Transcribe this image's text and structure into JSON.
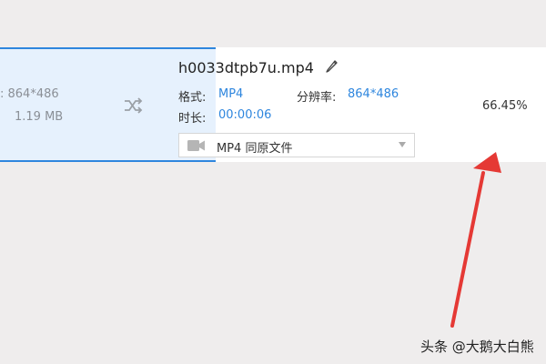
{
  "source_panel": {
    "resolution": ": 864*486",
    "size": "1.19 MB"
  },
  "output": {
    "filename": "h0033dtpb7u.mp4",
    "format_label": "格式:",
    "format_value": "MP4",
    "resolution_label": "分辨率:",
    "resolution_value": "864*486",
    "duration_label": "时长:",
    "duration_value": "00:00:06",
    "progress": "66.45%",
    "progress_value": 0.6645,
    "preset_value": "MP4  同原文件"
  },
  "icons": {
    "shuffle": "shuffle-icon",
    "edit": "pencil-icon",
    "video": "video-camera-icon",
    "dropdown": "chevron-down-icon"
  },
  "colors": {
    "accent": "#2e86de",
    "arrow": "#e53935",
    "selected_bg": "#e6f1fd"
  },
  "watermark": "头条 @大鹅大白熊"
}
